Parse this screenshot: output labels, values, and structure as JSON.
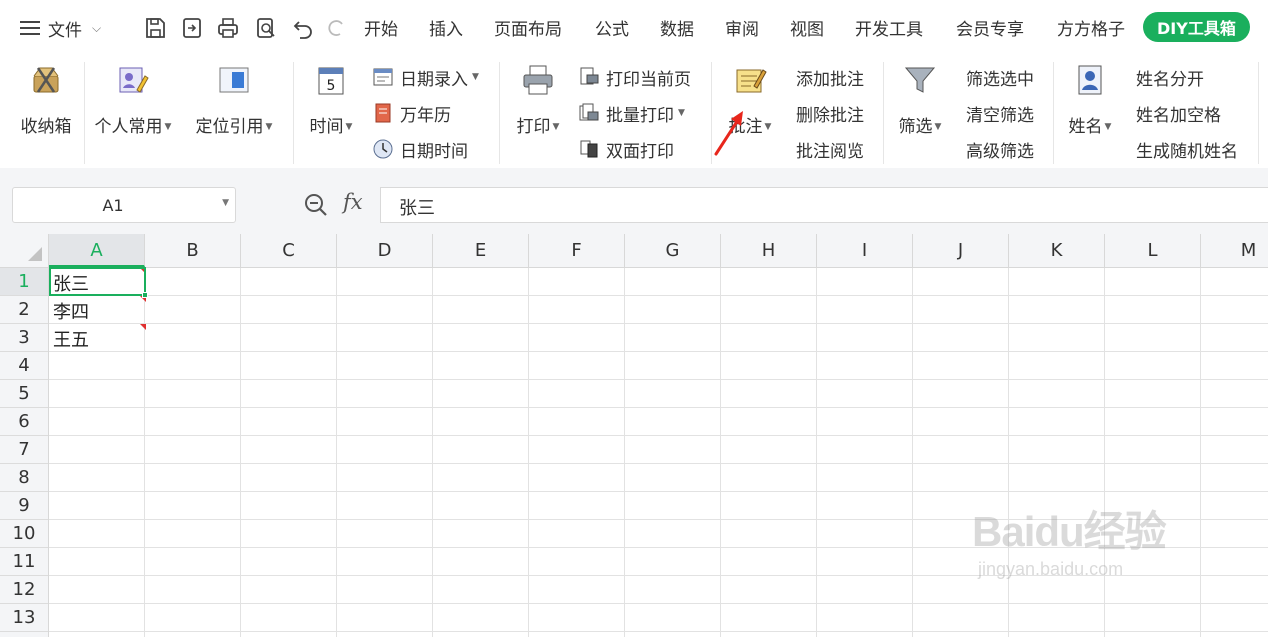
{
  "menu": {
    "file_label": "文件",
    "tabs": [
      "开始",
      "插入",
      "页面布局",
      "公式",
      "数据",
      "审阅",
      "视图",
      "开发工具",
      "会员专享",
      "方方格子"
    ],
    "active_tab": "DIY工具箱"
  },
  "ribbon": {
    "toolbox": "收纳箱",
    "personal": "个人常用",
    "locate": "定位引用",
    "time": "时间",
    "date_entry": "日期录入",
    "calendar": "万年历",
    "datetime": "日期时间",
    "print": "打印",
    "print_current": "打印当前页",
    "batch_print": "批量打印",
    "duplex_print": "双面打印",
    "comment": "批注",
    "add_comment": "添加批注",
    "delete_comment": "删除批注",
    "review_comment": "批注阅览",
    "filter": "筛选",
    "filter_selected": "筛选选中",
    "clear_filter": "清空筛选",
    "advanced_filter": "高级筛选",
    "name": "姓名",
    "split_name": "姓名分开",
    "name_add_space": "姓名加空格",
    "random_name": "生成随机姓名",
    "calendar_icon_day": "5"
  },
  "formula_bar": {
    "cell_ref": "A1",
    "fx": "fx",
    "value": "张三"
  },
  "grid": {
    "columns": [
      "A",
      "B",
      "C",
      "D",
      "E",
      "F",
      "G",
      "H",
      "I",
      "J",
      "K",
      "L",
      "M"
    ],
    "rows": [
      "1",
      "2",
      "3",
      "4",
      "5",
      "6",
      "7",
      "8",
      "9",
      "10",
      "11",
      "12",
      "13"
    ],
    "cells": {
      "A1": "张三",
      "A2": "李四",
      "A3": "王五"
    }
  },
  "watermark": {
    "brand": "Baidu经验",
    "url": "jingyan.baidu.com"
  },
  "colors": {
    "accent": "#1aaf5d",
    "comment_marker": "#e03030",
    "annotation_arrow": "#e8261c"
  }
}
